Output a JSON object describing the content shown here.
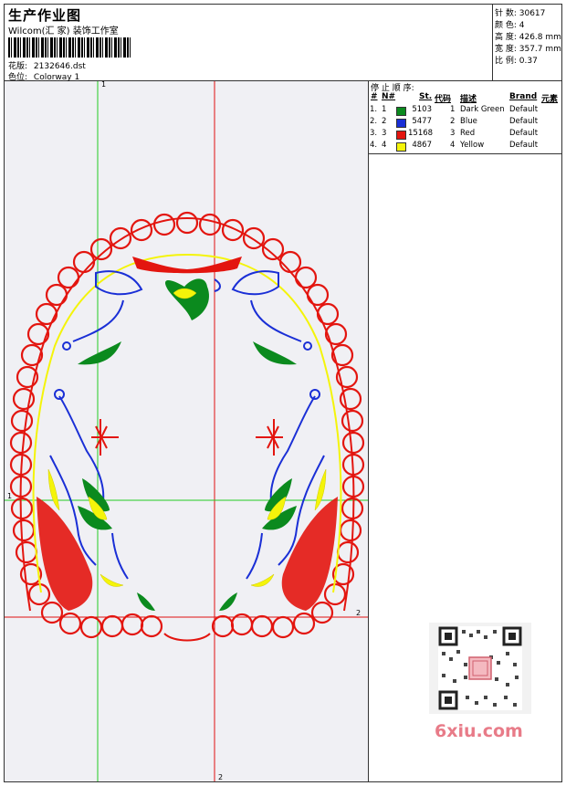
{
  "header": {
    "title": "生产作业图",
    "subtitle": "Wilcom(汇 家) 装饰工作室",
    "design_file_label": "花版:",
    "design_file": "2132646.dst",
    "colorway_label": "色位:",
    "colorway": "Colorway 1"
  },
  "stats": {
    "stitches": "针 数: 30617",
    "colors": "颜 色: 4",
    "height": "高 度: 426.8 mm",
    "width": "宽 度: 357.7 mm",
    "scale": "比 例: 0.37"
  },
  "stop_sequence": {
    "title": "停 止 顺 序:",
    "columns": [
      "#",
      "N#",
      "St.",
      "代码",
      "描述",
      "Brand",
      "元素"
    ],
    "rows": [
      {
        "idx": "1.",
        "n": "1",
        "st": "5103",
        "code": "1",
        "desc": "Dark Green",
        "brand": "Default",
        "color": "#0b8a1e"
      },
      {
        "idx": "2.",
        "n": "2",
        "st": "5477",
        "code": "2",
        "desc": "Blue",
        "brand": "Default",
        "color": "#1a2fd6"
      },
      {
        "idx": "3.",
        "n": "3",
        "st": "15168",
        "code": "3",
        "desc": "Red",
        "brand": "Default",
        "color": "#e3150f"
      },
      {
        "idx": "4.",
        "n": "4",
        "st": "4867",
        "code": "4",
        "desc": "Yellow",
        "brand": "Default",
        "color": "#f4f40a"
      }
    ]
  },
  "guides": {
    "v1_label": "1",
    "v2_label": "2",
    "h1_label": "1",
    "h2_label": "2"
  },
  "watermark": {
    "text": "6xiu.com"
  },
  "colors": {
    "guide_green": "#22cc22",
    "guide_red": "#e01010"
  }
}
